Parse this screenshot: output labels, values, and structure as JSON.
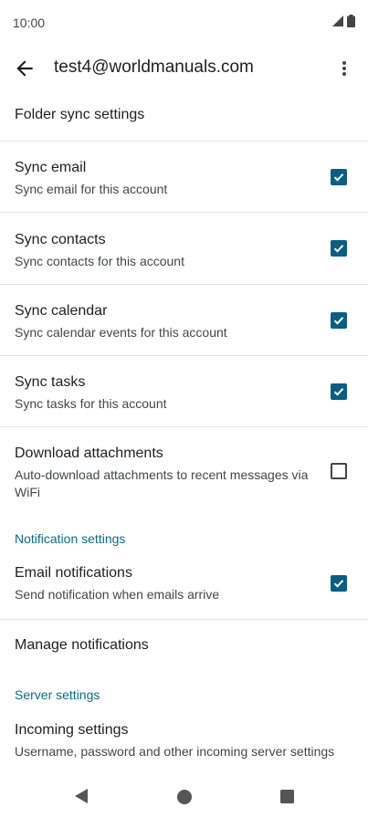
{
  "status_bar": {
    "time": "10:00"
  },
  "app_bar": {
    "title": "test4@worldmanuals.com"
  },
  "folder_sync": {
    "label": "Folder sync settings"
  },
  "sync_rows": [
    {
      "title": "Sync email",
      "subtitle": "Sync email for this account",
      "checked": true
    },
    {
      "title": "Sync contacts",
      "subtitle": "Sync contacts for this account",
      "checked": true
    },
    {
      "title": "Sync calendar",
      "subtitle": "Sync calendar events for this account",
      "checked": true
    },
    {
      "title": "Sync tasks",
      "subtitle": "Sync tasks for this account",
      "checked": true
    },
    {
      "title": "Download attachments",
      "subtitle": "Auto-download attachments to recent messages via WiFi",
      "checked": false
    }
  ],
  "notification_section": {
    "label": "Notification settings",
    "email_notifications": {
      "title": "Email notifications",
      "subtitle": "Send notification when emails arrive",
      "checked": true
    },
    "manage_notifications": {
      "title": "Manage notifications"
    }
  },
  "server_section": {
    "label": "Server settings",
    "incoming": {
      "title": "Incoming settings",
      "subtitle": "Username, password and other incoming server settings"
    }
  },
  "colors": {
    "accent": "#0b5d82",
    "category": "#0b6b8a",
    "divider": "#e3e3e3"
  },
  "icons": [
    "signal-icon",
    "battery-icon",
    "back-arrow-icon",
    "more-vert-icon",
    "checkbox-checked-icon",
    "checkbox-unchecked-icon",
    "nav-back-icon",
    "nav-home-icon",
    "nav-recents-icon"
  ]
}
